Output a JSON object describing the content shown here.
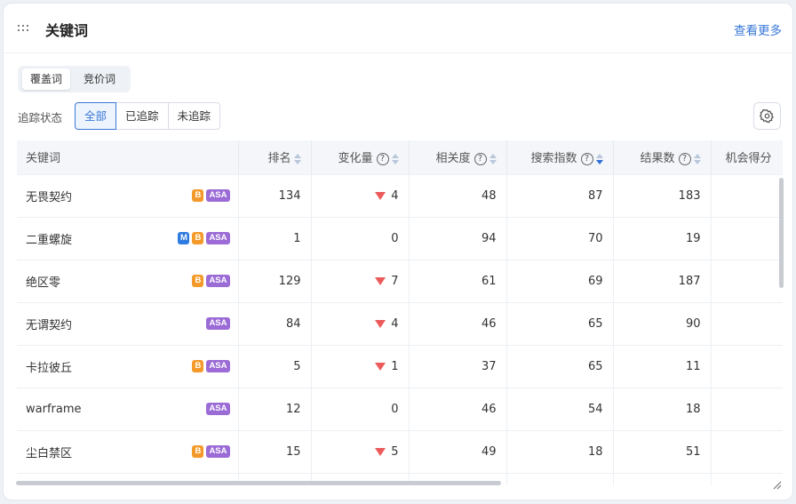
{
  "header": {
    "title": "关键词",
    "see_more": "查看更多"
  },
  "tabs": [
    {
      "label": "覆盖词",
      "active": true
    },
    {
      "label": "竞价词",
      "active": false
    }
  ],
  "tracking": {
    "label": "追踪状态",
    "options": [
      {
        "label": "全部",
        "active": true
      },
      {
        "label": "已追踪",
        "active": false
      },
      {
        "label": "未追踪",
        "active": false
      }
    ]
  },
  "columns": [
    "关键词",
    "排名",
    "变化量",
    "相关度",
    "搜索指数",
    "结果数",
    "机会得分"
  ],
  "colors": {
    "accent": "#3a78d8",
    "badge_m": "#2f7be0",
    "badge_b": "#f39a2a",
    "badge_asa": "#9b6bd6",
    "decrease": "#ec5b5b"
  },
  "rows": [
    {
      "keyword": "无畏契约",
      "badges": [
        "B",
        "ASA"
      ],
      "rank": "134",
      "change": "4",
      "down": true,
      "relevance": "48",
      "search_index": "87",
      "results": "183"
    },
    {
      "keyword": "二重螺旋",
      "badges": [
        "M",
        "B",
        "ASA"
      ],
      "rank": "1",
      "change": "0",
      "down": false,
      "relevance": "94",
      "search_index": "70",
      "results": "19"
    },
    {
      "keyword": "绝区零",
      "badges": [
        "B",
        "ASA"
      ],
      "rank": "129",
      "change": "7",
      "down": true,
      "relevance": "61",
      "search_index": "69",
      "results": "187"
    },
    {
      "keyword": "无谓契约",
      "badges": [
        "ASA"
      ],
      "rank": "84",
      "change": "4",
      "down": true,
      "relevance": "46",
      "search_index": "65",
      "results": "90"
    },
    {
      "keyword": "卡拉彼丘",
      "badges": [
        "B",
        "ASA"
      ],
      "rank": "5",
      "change": "1",
      "down": true,
      "relevance": "37",
      "search_index": "65",
      "results": "11"
    },
    {
      "keyword": "warframe",
      "badges": [
        "ASA"
      ],
      "rank": "12",
      "change": "0",
      "down": false,
      "relevance": "46",
      "search_index": "54",
      "results": "18"
    },
    {
      "keyword": "尘白禁区",
      "badges": [
        "B",
        "ASA"
      ],
      "rank": "15",
      "change": "5",
      "down": true,
      "relevance": "49",
      "search_index": "18",
      "results": "51"
    }
  ]
}
